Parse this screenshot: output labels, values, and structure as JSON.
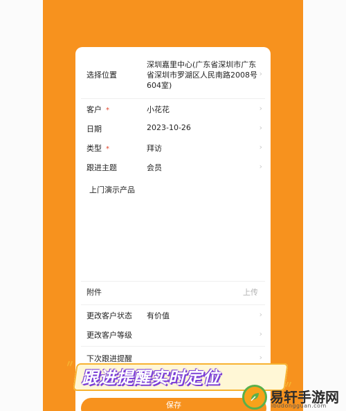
{
  "form": {
    "location_label": "选择位置",
    "location_value": "深圳嘉里中心(广东省深圳市广东省深圳市罗湖区人民南路2008号604室)",
    "customer_label": "客户",
    "customer_value": "小花花",
    "date_label": "日期",
    "date_value": "2023-10-26",
    "type_label": "类型",
    "type_value": "拜访",
    "topic_label": "跟进主题",
    "topic_value": "会员",
    "notes_value": "上门演示产品",
    "attachment_label": "附件",
    "attachment_action": "上传",
    "status_label": "更改客户状态",
    "status_value": "有价值",
    "level_label": "更改客户等级",
    "reminder_label": "下次跟进提醒",
    "required_mark": "*",
    "save_label": "保存"
  },
  "banner": {
    "text": "跟进提醒实时定位"
  },
  "watermark": {
    "title": "易轩手游网",
    "domain": "ibudongguan.com"
  },
  "colors": {
    "brand_orange": "#f7921e",
    "required_red": "#e0452b",
    "banner_purple": "#7b3fd6"
  }
}
